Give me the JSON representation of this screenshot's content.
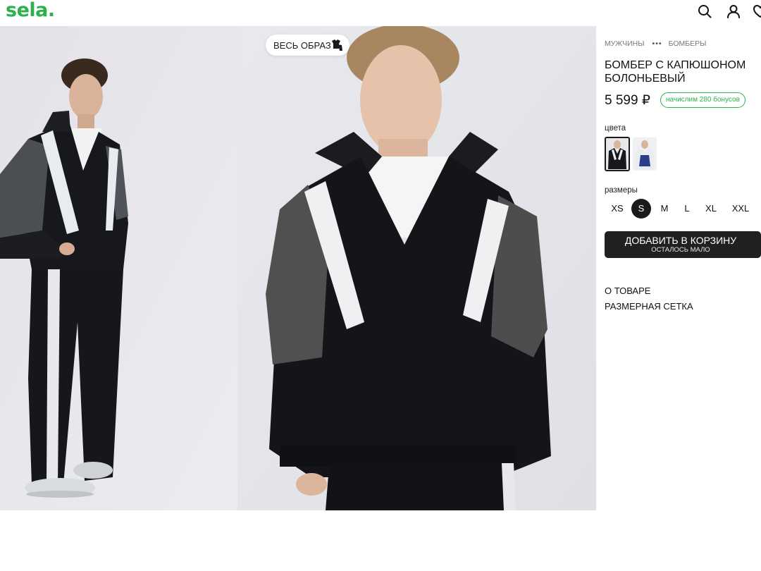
{
  "header": {
    "logo_text": "sela.",
    "brand_color": "#2bb24c",
    "icons": [
      "search-icon",
      "profile-icon",
      "heart-icon"
    ]
  },
  "gallery": {
    "look_button_label": "ВЕСЬ ОБРАЗ",
    "look_icon": "outfit-icon",
    "photos": [
      "model-full-body-photo",
      "model-closeup-photo"
    ]
  },
  "breadcrumb": {
    "items": [
      "МУЖЧИНЫ",
      "БОМБЕРЫ"
    ],
    "separator": "•••"
  },
  "product": {
    "title": "БОМБЕР С КАПЮШОНОМ БОЛОНЬЕВЫЙ",
    "price": "5 599 ₽",
    "bonus": "начислим 280 бонусов"
  },
  "colors": {
    "label": "цвета",
    "swatches": [
      {
        "name": "black-white",
        "selected": true
      },
      {
        "name": "navy-white",
        "selected": false
      }
    ]
  },
  "sizes": {
    "label": "размеры",
    "options": [
      "XS",
      "S",
      "M",
      "L",
      "XL",
      "XXL"
    ],
    "selected": "S"
  },
  "cart": {
    "button_label": "ДОБАВИТЬ В КОРЗИНУ",
    "stock_note": "ОСТАЛОСЬ МАЛО"
  },
  "links": {
    "about": "О ТОВАРЕ",
    "size_chart": "РАЗМЕРНАЯ СЕТКА"
  }
}
